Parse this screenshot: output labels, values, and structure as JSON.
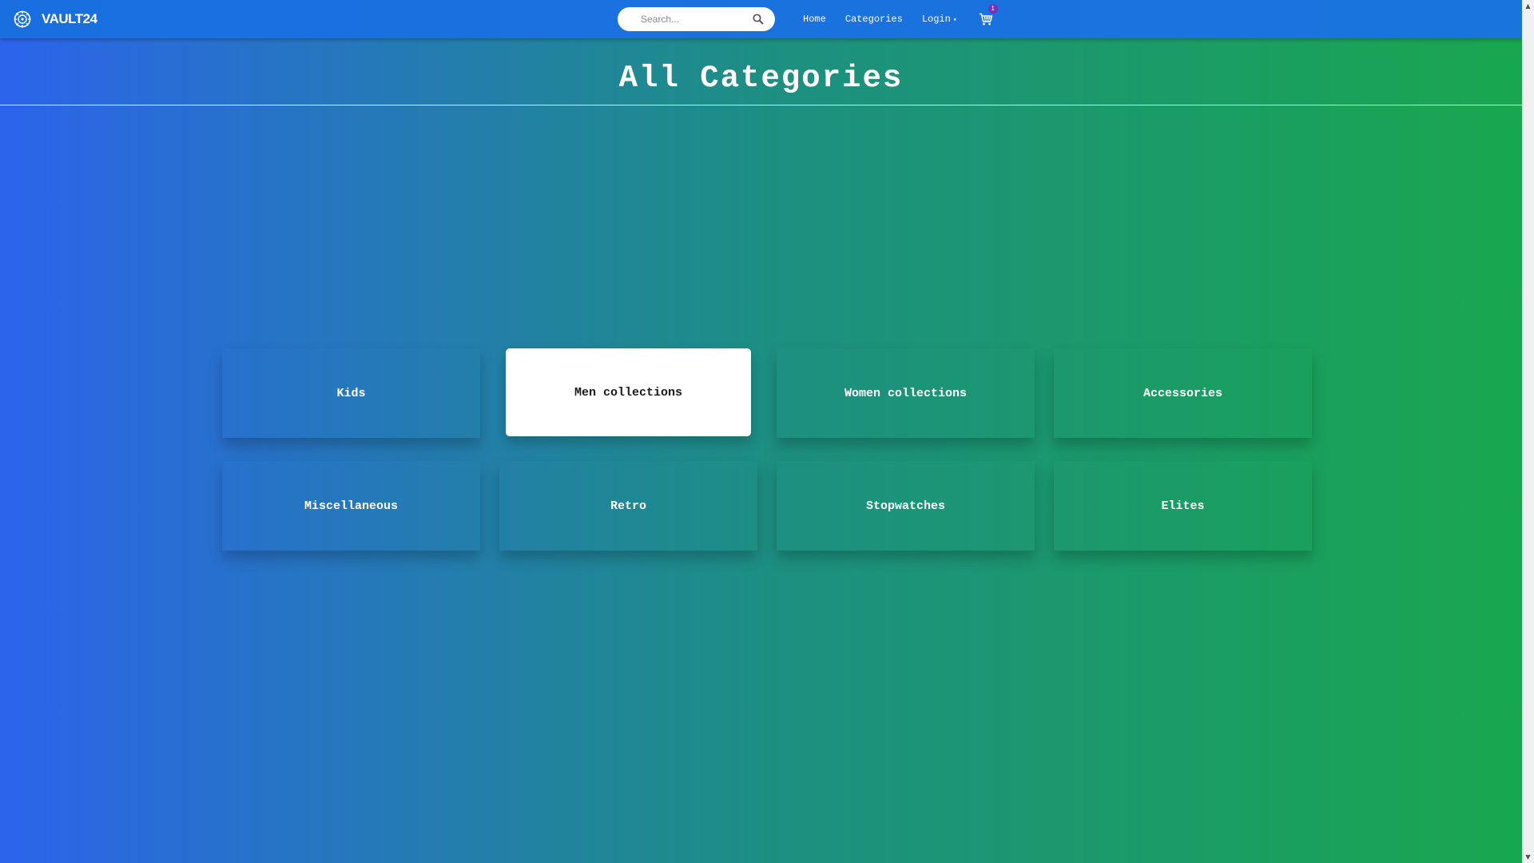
{
  "brand": {
    "name": "VAULT24",
    "logo_icon": "vault-dial-icon"
  },
  "search": {
    "placeholder": "Search...",
    "icon": "search-icon"
  },
  "nav": {
    "home": "Home",
    "categories": "Categories",
    "login": "Login",
    "cart_count": "1"
  },
  "page": {
    "title": "All Categories"
  },
  "categories": [
    "Kids",
    "Men collections",
    "Women collections",
    "Accessories",
    "Miscellaneous",
    "Retro",
    "Stopwatches",
    "Elites"
  ],
  "colors": {
    "navbar": "#1a6fe0",
    "gradient_start": "#2c64ec",
    "gradient_end": "#19a74e",
    "badge": "#7b2fb5"
  }
}
